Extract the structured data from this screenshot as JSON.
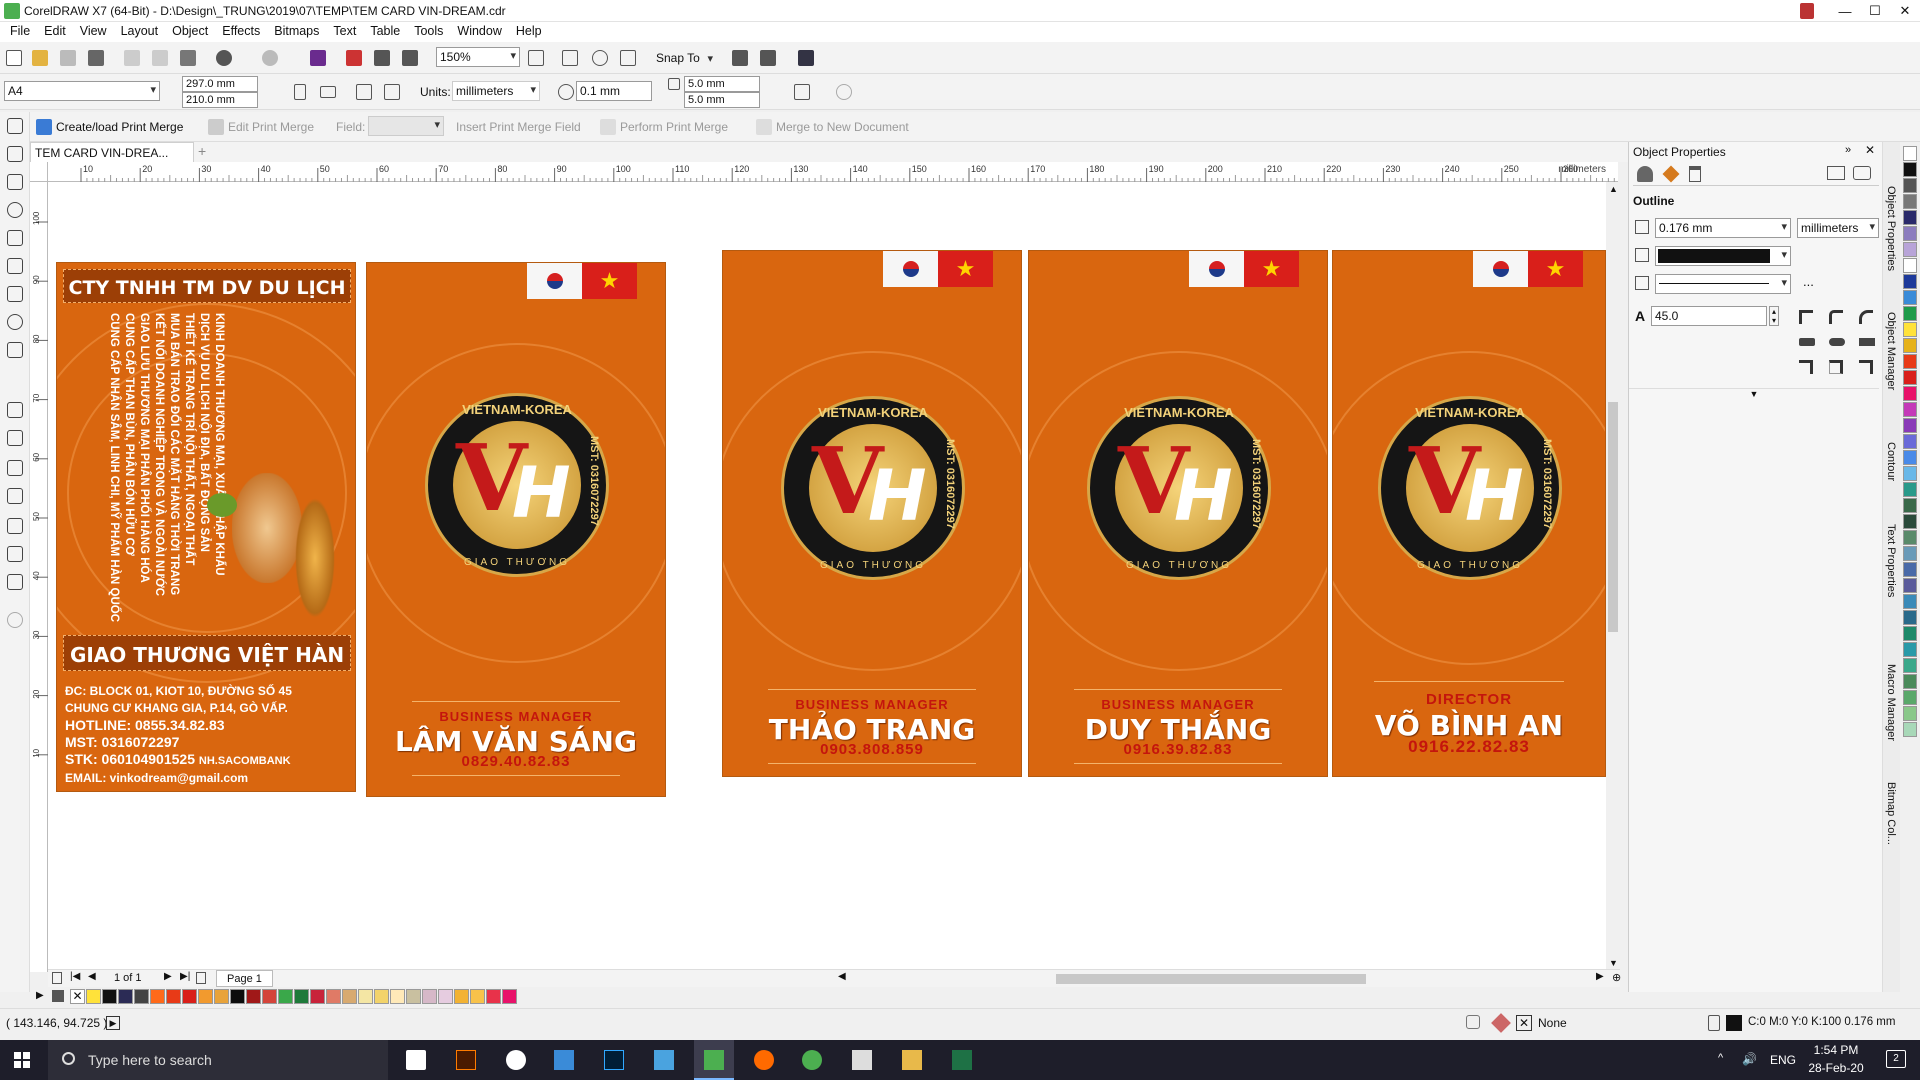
{
  "window": {
    "title": "CorelDRAW X7 (64-Bit) - D:\\Design\\_TRUNG\\2019\\07\\TEMP\\TEM CARD VIN-DREAM.cdr",
    "controls": [
      "—",
      "☐",
      "✕"
    ]
  },
  "menu": [
    "File",
    "Edit",
    "View",
    "Layout",
    "Object",
    "Effects",
    "Bitmaps",
    "Text",
    "Table",
    "Tools",
    "Window",
    "Help"
  ],
  "toolbar1": {
    "zoom": "150%",
    "snap_to": "Snap To"
  },
  "toolbar2": {
    "page_size": "A4",
    "width": "297.0 mm",
    "height": "210.0 mm",
    "units_label": "Units:",
    "units_value": "millimeters",
    "nudge": "0.1 mm",
    "dup_x": "5.0 mm",
    "dup_y": "5.0 mm"
  },
  "printmerge": {
    "create": "Create/load Print Merge",
    "edit": "Edit Print Merge",
    "field_label": "Field:",
    "insert": "Insert Print Merge Field",
    "perform": "Perform Print Merge",
    "merge_new": "Merge to New Document"
  },
  "document_tab": "TEM CARD VIN-DREA...",
  "ruler": {
    "h_ticks": [
      "10",
      "20",
      "30",
      "40",
      "50",
      "60",
      "70",
      "80",
      "90",
      "100",
      "110",
      "120",
      "130",
      "140",
      "150",
      "160",
      "170",
      "180",
      "190",
      "200",
      "210",
      "220",
      "230",
      "240",
      "250",
      "260"
    ],
    "unit": "millimeters",
    "v_ticks": [
      "100",
      "90",
      "80",
      "70",
      "60",
      "50",
      "40",
      "30",
      "20",
      "10"
    ]
  },
  "page_nav": {
    "count": "1 of 1",
    "page_tab": "Page 1"
  },
  "status": {
    "coords": "( 143.146, 94.725 )",
    "fill": "None",
    "outline": "C:0 M:0 Y:0 K:100  0.176 mm"
  },
  "docker": {
    "title": "Object Properties",
    "section": "Outline",
    "width": "0.176 mm",
    "width_units": "millimeters",
    "angle": "45.0",
    "more": "..."
  },
  "docker_tabs": [
    "Object Properties",
    "Object Manager",
    "Contour",
    "Text Properties",
    "Macro Manager",
    "Bitmap Col..."
  ],
  "back_card": {
    "company": "CTY TNHH TM DV DU LỊCH",
    "services": [
      "KINH DOANH THƯƠNG MẠI, XUẤT NHẬP KHẨU",
      "DỊCH VỤ DU LỊCH NỘI ĐỊA, BẤT ĐỘNG SẢN",
      "THIẾT KẾ TRANG TRÍ NỘI THẤT, NGOẠI THẤT",
      "MUA BÁN TRAO ĐỔI CÁC MẶT HÀNG THỜI TRANG",
      "KẾT NỐI DOANH NGHIỆP TRONG VÀ NGOÀI NƯỚC",
      "GIAO LƯU THƯƠNG MẠI PHÂN PHỐI HÀNG HÓA",
      "CUNG CẤP THAN BÙN, PHÂN BÓN HỮU CƠ",
      "CUNG CẤP NHÂN SÂM, LINH CHI, MỸ PHẨM HÀN QUỐC"
    ],
    "brand": "GIAO THƯƠNG VIỆT HÀN",
    "address1": "ĐC: BLOCK 01, KIOT 10, ĐƯỜNG SỐ 45",
    "address2": "CHUNG CƯ KHANG GIA, P.14, GÒ VẤP.",
    "hotline": "HOTLINE: 0855.34.82.83",
    "mst": "MST: 0316072297",
    "stk": "STK: 060104901525",
    "bank": "NH.SACOMBANK",
    "email": "EMAIL: vinkodream@gmail.com"
  },
  "emblem": {
    "top_text": "VIETNAM-KOREA",
    "side_text": "MST: 0316072297",
    "bottom_text": "GIAO THƯƠNG"
  },
  "cards": [
    {
      "role": "BUSINESS MANAGER",
      "name": "LÂM VĂN SÁNG",
      "phone": "0829.40.82.83"
    },
    {
      "role": "BUSINESS MANAGER",
      "name": "THẢO TRANG",
      "phone": "0903.808.859"
    },
    {
      "role": "BUSINESS MANAGER",
      "name": "DUY THẮNG",
      "phone": "0916.39.82.83"
    },
    {
      "role": "DIRECTOR",
      "name": "VÕ BÌNH AN",
      "phone": "0916.22.82.83"
    }
  ],
  "taskbar": {
    "search": "Type here to search",
    "lang": "ENG",
    "time": "1:54 PM",
    "date": "28-Feb-20",
    "notif": "2"
  },
  "colors": {
    "card_orange": "#d9660f",
    "accent_red": "#c4150d",
    "gold": "#d7a748"
  }
}
